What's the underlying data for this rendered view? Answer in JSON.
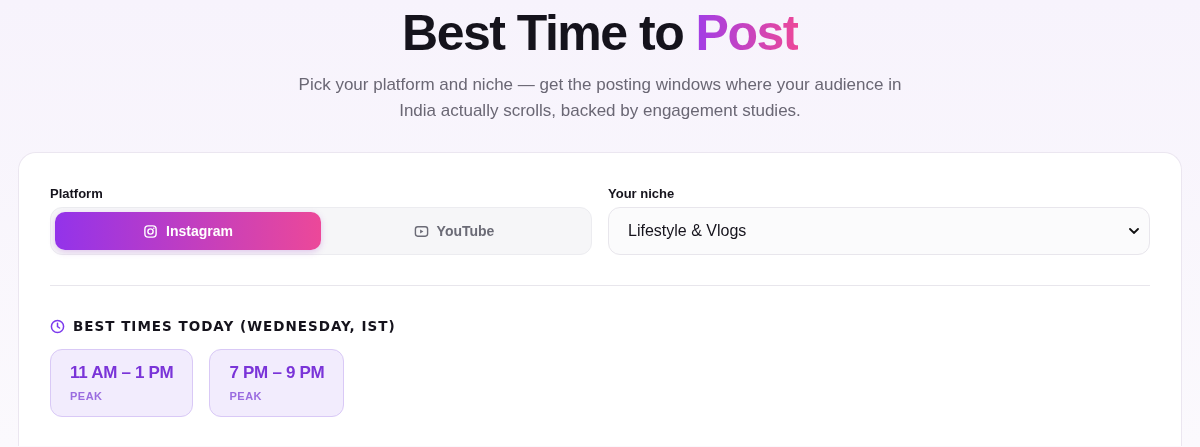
{
  "header": {
    "title": "Best Time to",
    "title_highlight": "Post",
    "subtitle": "Pick your platform and niche — get the posting windows where your audience in India actually scrolls, backed by engagement studies."
  },
  "platform": {
    "label": "Platform",
    "options": [
      {
        "label": "Instagram",
        "kind": "camera",
        "selected": true
      },
      {
        "label": "YouTube",
        "kind": "play",
        "selected": false
      }
    ]
  },
  "niche": {
    "label": "Your niche",
    "value": "Lifestyle & Vlogs"
  },
  "best_times": {
    "heading": "BEST TIMES TODAY (WEDNESDAY, IST)",
    "slots": [
      {
        "time": "11 AM – 1 PM",
        "tag": "PEAK"
      },
      {
        "time": "7 PM – 9 PM",
        "tag": "PEAK"
      }
    ]
  }
}
